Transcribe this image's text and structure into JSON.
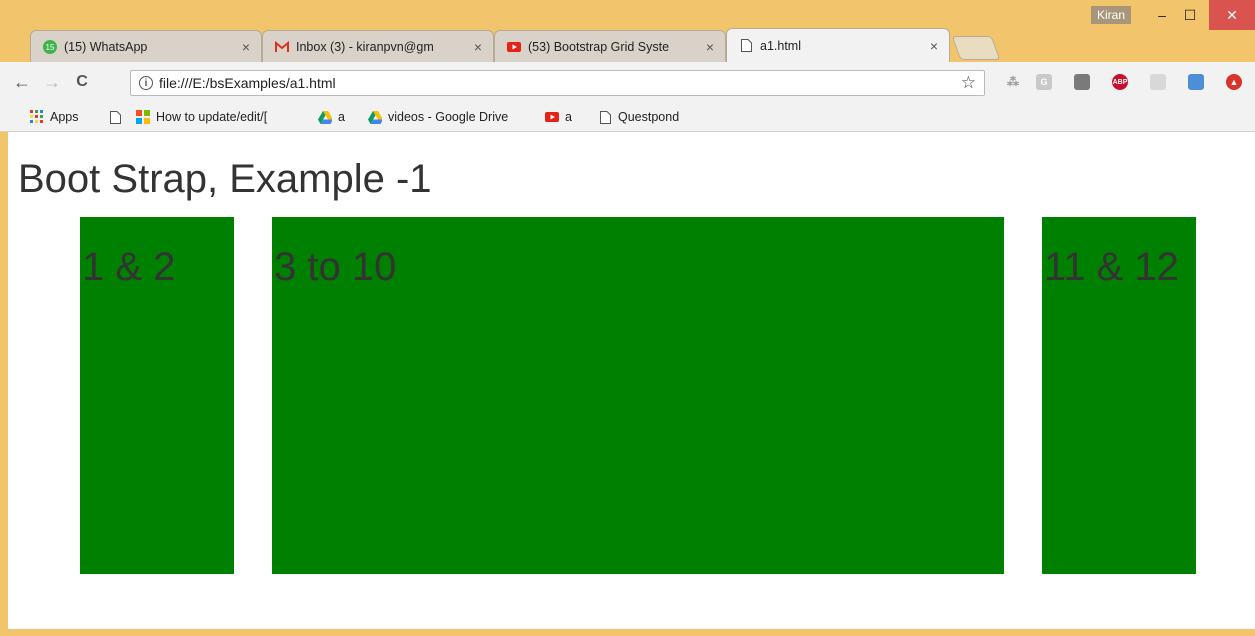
{
  "window": {
    "profile_name": "Kiran",
    "minimize": "–",
    "maximize": "☐",
    "close": "✕"
  },
  "tabs": [
    {
      "title": "(15) WhatsApp",
      "badge": "15",
      "close": "×"
    },
    {
      "title": "Inbox (3) - kiranpvn@gm",
      "close": "×"
    },
    {
      "title": "(53) Bootstrap Grid Syste",
      "close": "×"
    },
    {
      "title": "a1.html",
      "close": "×"
    }
  ],
  "toolbar": {
    "back": "←",
    "forward": "→",
    "reload": "C",
    "url": "file:///E:/bsExamples/a1.html",
    "info_icon": "i",
    "bookmark_star": "☆"
  },
  "extensions": {
    "abp_label": "ABP"
  },
  "bookmarks": [
    {
      "label": "Apps",
      "icon": "apps-grid-icon"
    },
    {
      "label": "",
      "icon": "page-icon"
    },
    {
      "label": "How to update/edit/[",
      "icon": "microsoft-icon"
    },
    {
      "label": "a",
      "icon": "google-drive-icon"
    },
    {
      "label": "videos - Google Drive",
      "icon": "google-drive-icon"
    },
    {
      "label": "a",
      "icon": "youtube-icon"
    },
    {
      "label": "Questpond",
      "icon": "page-icon"
    }
  ],
  "page": {
    "heading": "Boot Strap, Example -1",
    "columns": [
      {
        "label": "1 & 2"
      },
      {
        "label": "3 to 10"
      },
      {
        "label": "11 & 12"
      }
    ]
  },
  "colors": {
    "frame": "#f2c46c",
    "column_green": "#008000",
    "text": "#333333"
  }
}
